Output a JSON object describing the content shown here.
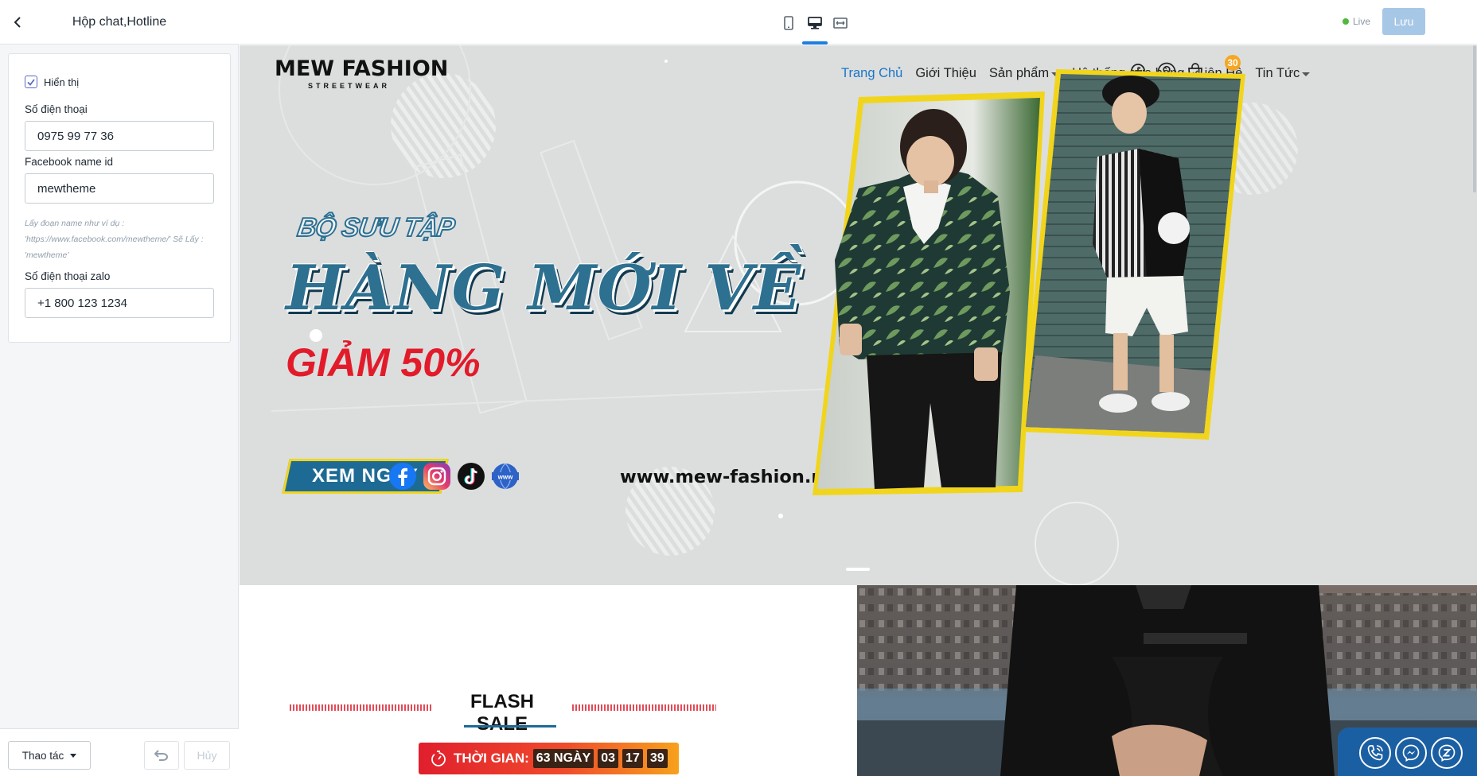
{
  "panel": {
    "title": "Hộp chat,Hotline",
    "show_label": "Hiển thị",
    "phone_label": "Số điện thoại",
    "phone_value": "0975 99 77 36",
    "facebook_label": "Facebook name id",
    "facebook_value": "mewtheme",
    "facebook_help": "Lấy đoạn name như ví dụ : 'https://www.facebook.com/mewtheme/' Sẽ Lấy : 'mewtheme'",
    "zalo_label": "Số điện thoại zalo",
    "zalo_value": "+1 800 123 1234",
    "actions_label": "Thao tác",
    "cancel_label": "Hủy"
  },
  "toolbar": {
    "live_label": "Live",
    "save_label": "Lưu",
    "accent_color": "#1c7ee3",
    "devices": [
      "mobile-icon",
      "desktop-icon",
      "fullwidth-icon"
    ]
  },
  "store": {
    "logo_text": "MEW FASHION",
    "logo_subtext": "STREETWEAR",
    "nav": [
      {
        "label": "Trang Chủ"
      },
      {
        "label": "Giới Thiệu"
      },
      {
        "label": "Sản phẩm"
      },
      {
        "label": "Hệ thống cửa hàng"
      },
      {
        "label": "Liên Hệ"
      },
      {
        "label": "Tin Tức"
      }
    ],
    "cart_count": "30"
  },
  "banner": {
    "kicker": "BỘ SƯU TẬP",
    "title": "HÀNG MỚI VỀ",
    "sale": "GIẢM 50%",
    "cta": "XEM NGAY",
    "url": "www.mew-fashion.mysapo.net",
    "social": [
      "facebook-icon",
      "instagram-icon",
      "tiktok-icon",
      "www-icon"
    ]
  },
  "flash_sale": {
    "title": "FLASH SALE",
    "countdown_label": "THỜI GIAN:",
    "days": "63 NGÀY",
    "hours": "03",
    "minutes": "17",
    "seconds": "39"
  },
  "widgets": [
    "phone-icon",
    "messenger-icon",
    "zalo-icon"
  ]
}
